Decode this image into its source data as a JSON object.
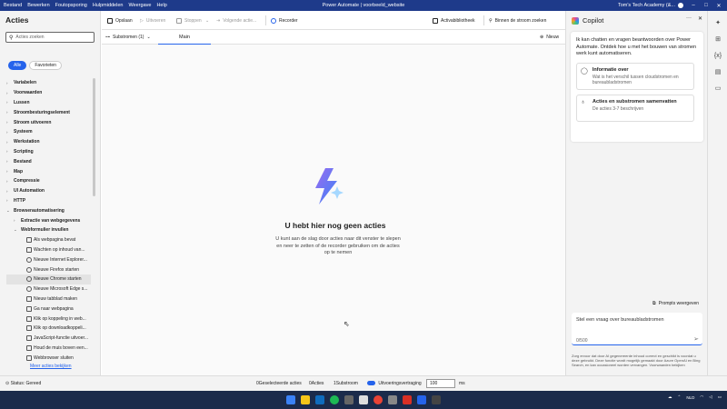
{
  "window": {
    "title": "Power Automate | voorbeeld_website",
    "user": "Tom's Tech Academy (&...",
    "menu": [
      "Bestand",
      "Bewerken",
      "Foutopsporing",
      "Hulpmiddelen",
      "Weergave",
      "Help"
    ]
  },
  "actions_panel": {
    "title": "Acties",
    "search_placeholder": "Acties zoeken",
    "filters": [
      "Alle",
      "Favorieten"
    ],
    "tree": [
      {
        "label": "Variabelen",
        "level": 0
      },
      {
        "label": "Voorwaarden",
        "level": 0
      },
      {
        "label": "Lussen",
        "level": 0
      },
      {
        "label": "Stroombesturingselement",
        "level": 0
      },
      {
        "label": "Stroom uitvoeren",
        "level": 0
      },
      {
        "label": "Systeem",
        "level": 0
      },
      {
        "label": "Werkstation",
        "level": 0
      },
      {
        "label": "Scripting",
        "level": 0
      },
      {
        "label": "Bestand",
        "level": 0
      },
      {
        "label": "Map",
        "level": 0
      },
      {
        "label": "Compressie",
        "level": 0
      },
      {
        "label": "UI Automation",
        "level": 0
      },
      {
        "label": "HTTP",
        "level": 0
      },
      {
        "label": "Browserautomatisering",
        "level": 0,
        "expanded": true
      },
      {
        "label": "Extractie van webgegevens",
        "level": 1
      },
      {
        "label": "Webformulier invullen",
        "level": 1,
        "expanded": true
      },
      {
        "label": "Als webpagina bevat",
        "level": 2,
        "icon": "doc"
      },
      {
        "label": "Wachten op inhoud van...",
        "level": 2,
        "icon": "doc"
      },
      {
        "label": "Nieuwe Internet Explorer...",
        "level": 2,
        "icon": "globe"
      },
      {
        "label": "Nieuwe Firefox starten",
        "level": 2,
        "icon": "globe"
      },
      {
        "label": "Nieuwe Chrome starten",
        "level": 2,
        "icon": "globe",
        "selected": true
      },
      {
        "label": "Nieuwe Microsoft Edge s...",
        "level": 2,
        "icon": "globe"
      },
      {
        "label": "Nieuw tabblad maken",
        "level": 2,
        "icon": "doc"
      },
      {
        "label": "Ga naar webpagina",
        "level": 2,
        "icon": "doc"
      },
      {
        "label": "Klik op koppeling in web...",
        "level": 2,
        "icon": "doc"
      },
      {
        "label": "Klik op downloadkoppeli...",
        "level": 2,
        "icon": "doc"
      },
      {
        "label": "JavaScript-functie uitvoer...",
        "level": 2,
        "icon": "doc"
      },
      {
        "label": "Houd de muis boven een...",
        "level": 2,
        "icon": "doc"
      },
      {
        "label": "Webbrowser sluiten",
        "level": 2,
        "icon": "doc"
      }
    ],
    "more_link": "Meer acties bekijken"
  },
  "toolbar": {
    "save": "Opslaan",
    "run": "Uitvoeren",
    "stop": "Stoppen",
    "next": "Volgende actie...",
    "recorder": "Recorder",
    "library": "Activabibliotheek",
    "search_flow": "Binnen de stroom zoeken"
  },
  "subbar": {
    "subflows": "Substromen (1)",
    "tab_main": "Main",
    "new": "Nieuw"
  },
  "canvas": {
    "empty_title": "U hebt hier nog geen acties",
    "empty_desc": "U kunt aan de slag door acties naar dit venster te slepen en neer te zetten of de recorder gebruiken om de acties op te nemen"
  },
  "copilot": {
    "title": "Copilot",
    "intro": "Ik kan chatten en vragen beantwoorden over Power Automate. Ontdek hoe u met het bouwen van stromen werk kunt automatiseren.",
    "cards": [
      {
        "title": "Informatie over",
        "subtitle": "Wat is het verschil tussen cloudstromen en bureaubladstromen"
      },
      {
        "title": "Acties en substromen samenvatten",
        "subtitle": "De acties 3-7 beschrijven"
      }
    ],
    "prompts": "Prompts weergeven",
    "input_placeholder": "Stel een vraag over bureaubladstromen",
    "counter": "0/500",
    "disclaimer": "Zorg ervoor dat door AI gegenereerde inhoud correct en geschikt is voordat u deze gebruikt. Deze functie wordt mogelijk gemaakt door Azure OpenAI en Bing Search, en kan occasioneel worden vervangen. Voorwaarden bekijken",
    "disclaimer_link": "Voorwaarden bekijken"
  },
  "status": {
    "state": "Status: Gereed",
    "selected": "0Geselecteerde acties",
    "actions": "0Acties",
    "subflows": "1Substroom",
    "delay_label": "Uitvoeringsvertraging",
    "delay_value": "100",
    "unit": "ms"
  },
  "tray": {
    "lang": "NLD"
  }
}
